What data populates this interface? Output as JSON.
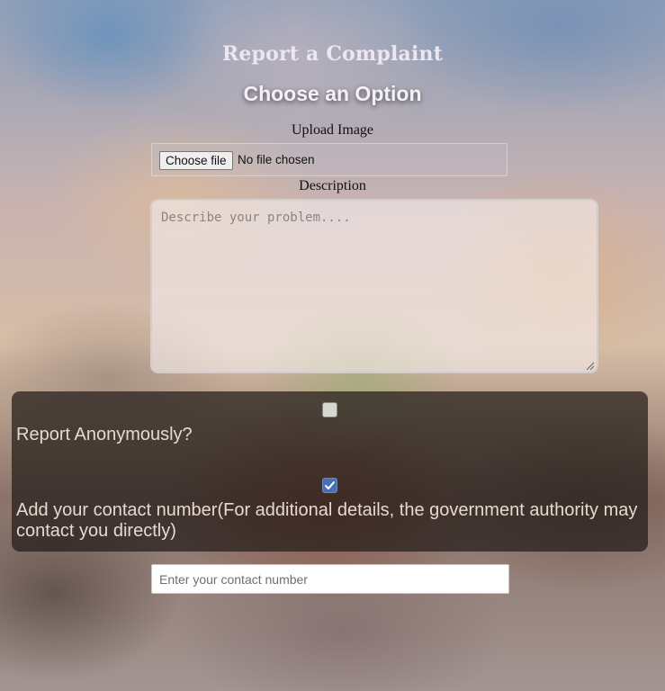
{
  "page": {
    "title": "Report a Complaint",
    "subtitle": "Choose an Option"
  },
  "upload": {
    "label": "Upload Image",
    "button_label": "Choose file",
    "status": "No file chosen"
  },
  "description": {
    "label": "Description",
    "placeholder": "Describe your problem....",
    "value": ""
  },
  "options": {
    "anonymous": {
      "label": "Report Anonymously?",
      "checked": false
    },
    "contact": {
      "label": "Add your contact number(For additional details, the government authority may contact you directly)",
      "checked": true,
      "checkbox_color": "#4a6fb5"
    }
  },
  "contact_input": {
    "placeholder": "Enter your contact number",
    "value": ""
  }
}
